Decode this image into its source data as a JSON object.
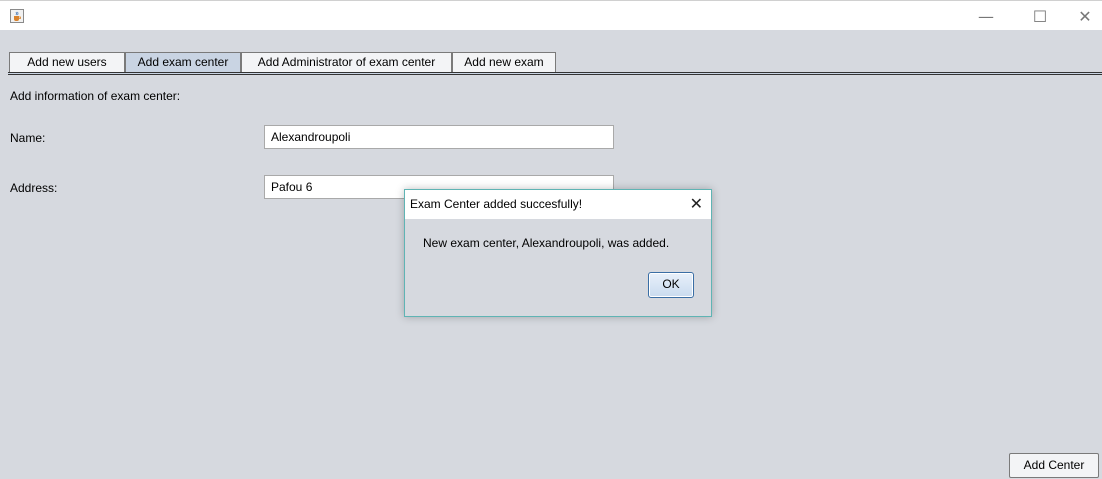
{
  "window": {
    "icon": "java-cup-icon",
    "controls": {
      "minimize": "—",
      "maximize": "☐",
      "close": "✕"
    }
  },
  "tabs": [
    {
      "label": "Add new users",
      "selected": false
    },
    {
      "label": "Add exam center",
      "selected": true
    },
    {
      "label": "Add Administrator of exam center",
      "selected": false
    },
    {
      "label": "Add new exam",
      "selected": false
    }
  ],
  "form": {
    "heading": "Add information of exam center:",
    "name_label": "Name:",
    "name_value": "Alexandroupoli",
    "address_label": "Address:",
    "address_value": "Pafou 6",
    "submit_label": "Add Center"
  },
  "dialog": {
    "title": "Exam Center added succesfully!",
    "close": "✕",
    "message": "New exam center, Alexandroupoli, was added.",
    "ok_label": "OK"
  }
}
